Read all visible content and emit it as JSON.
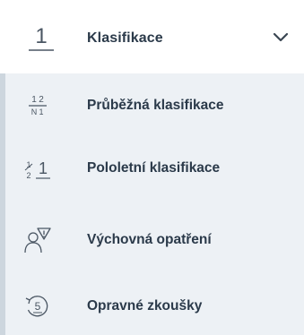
{
  "header": {
    "label": "Klasifikace",
    "icon": "numeral-one-icon",
    "icon_text": "1"
  },
  "items": [
    {
      "label": "Průběžná klasifikace",
      "icon": "fraction-grid-icon",
      "icon_text": [
        "1",
        "2",
        "N",
        "1"
      ]
    },
    {
      "label": "Pololetní klasifikace",
      "icon": "half-one-icon",
      "icon_text": [
        "1",
        "2",
        "1"
      ]
    },
    {
      "label": "Výchovná opatření",
      "icon": "person-warning-icon"
    },
    {
      "label": "Opravné zkoušky",
      "icon": "retake-five-icon",
      "icon_text": "5"
    }
  ],
  "colors": {
    "text": "#2b3a4a",
    "submenu_bg": "#edf1f5",
    "submenu_border": "#cdd6de",
    "icon": "#4a5663"
  }
}
